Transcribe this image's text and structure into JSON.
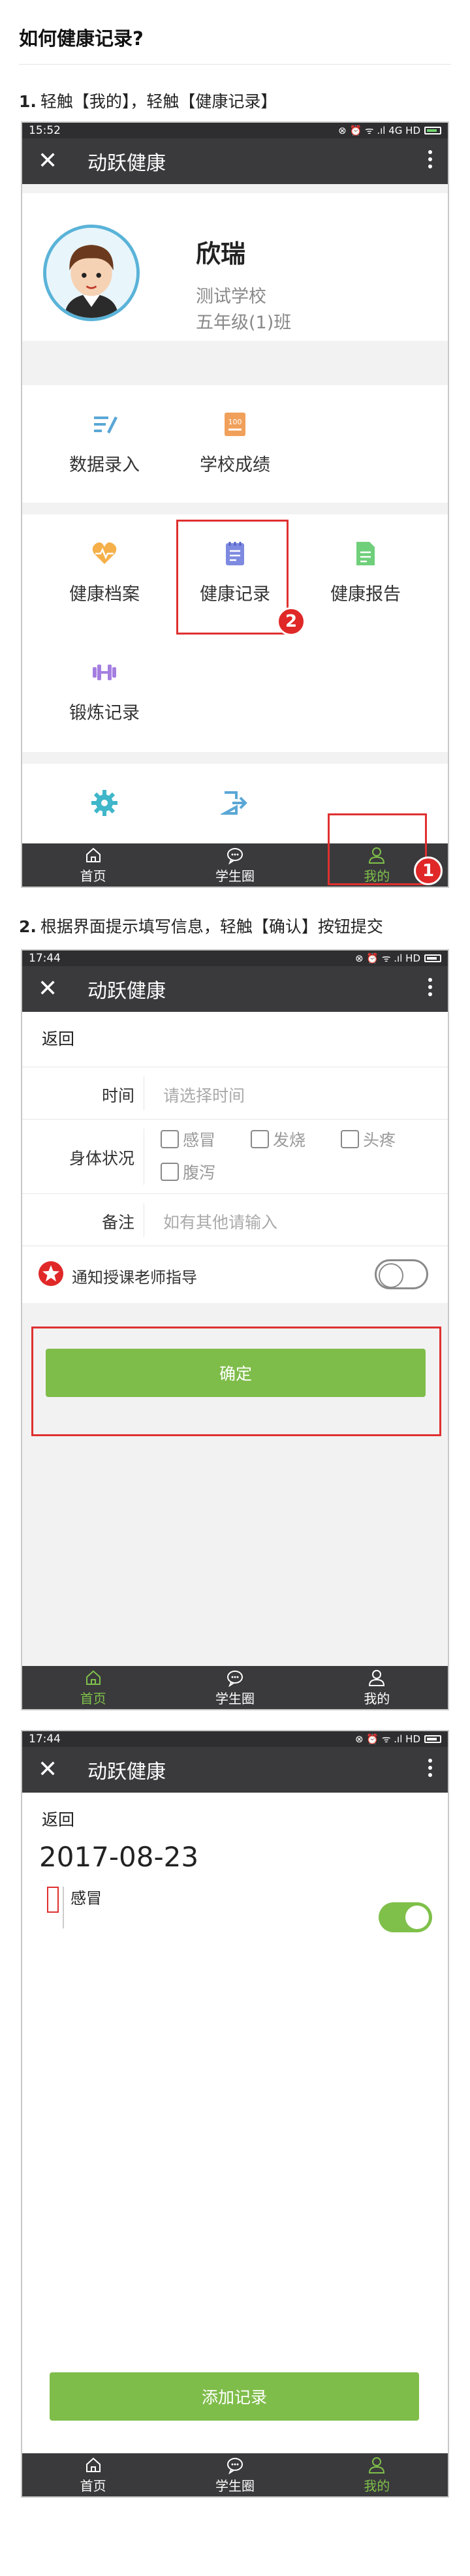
{
  "page_title": "如何健康记录?",
  "step1": {
    "number": "1.",
    "text": "轻触【我的】，轻触【健康记录】"
  },
  "step2": {
    "number": "2.",
    "text": "根据界面提示填写信息，轻触【确认】按钮提交"
  },
  "app": {
    "title": "动跃健康"
  },
  "screen1": {
    "status_time": "15:52",
    "status_icons": "⊗ ⏰ ᯤ .ıl 4G HD",
    "profile": {
      "name": "欣瑞",
      "school": "测试学校",
      "class": "五年级(1)班"
    },
    "grid1": [
      {
        "label": "数据录入",
        "icon": "data-entry-icon"
      },
      {
        "label": "学校成绩",
        "icon": "score-icon"
      }
    ],
    "grid2": [
      {
        "label": "健康档案",
        "icon": "heart-icon"
      },
      {
        "label": "健康记录",
        "icon": "notebook-icon"
      },
      {
        "label": "健康报告",
        "icon": "report-icon"
      },
      {
        "label": "锻炼记录",
        "icon": "dumbbell-icon"
      }
    ],
    "badge1": "1",
    "badge2": "2"
  },
  "screen2": {
    "status_time": "17:44",
    "status_icons": "⊗ ⏰ ᯤ .ıl HD",
    "back": "返回",
    "time_label": "时间",
    "time_placeholder": "请选择时间",
    "condition_label": "身体状况",
    "conditions": [
      "感冒",
      "发烧",
      "头疼",
      "腹泻"
    ],
    "note_label": "备注",
    "note_placeholder": "如有其他请输入",
    "notify_label": "通知授课老师指导",
    "confirm": "确定"
  },
  "screen3": {
    "status_time": "17:44",
    "status_icons": "⊗ ⏰ ᯤ .ıl HD",
    "back": "返回",
    "date": "2017-08-23",
    "record": "感冒",
    "add_button": "添加记录"
  },
  "tabs": [
    {
      "label": "首页",
      "icon": "home-icon"
    },
    {
      "label": "学生圈",
      "icon": "chat-icon"
    },
    {
      "label": "我的",
      "icon": "user-icon"
    }
  ],
  "colors": {
    "accent": "#7fc04a",
    "highlight": "#e03030",
    "dark": "#3a3a3c"
  }
}
